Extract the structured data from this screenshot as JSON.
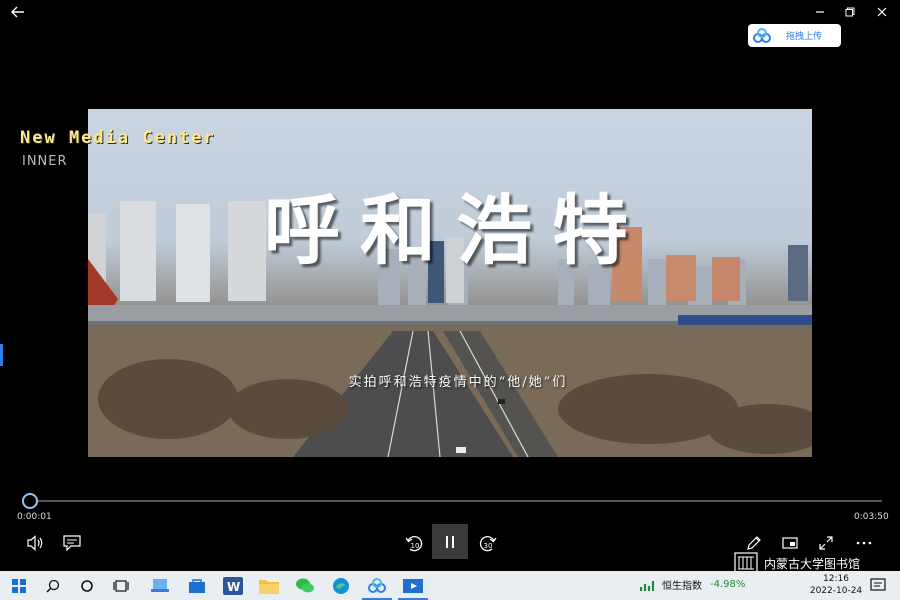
{
  "window": {
    "back_icon": "back-arrow-icon",
    "minimize_icon": "minimize-icon",
    "maximize_icon": "maximize-icon",
    "close_icon": "close-icon"
  },
  "upload": {
    "label": "拖拽上传",
    "icon": "baidu-cloud-icon",
    "accent": "#2f7de8"
  },
  "video": {
    "logo_text": "New Media Center",
    "logo_sub": "INNER",
    "title": "呼和浩特",
    "subtitle": "实拍呼和浩特疫情中的“他/她”们"
  },
  "player": {
    "current_time": "0:00:01",
    "total_time": "0:03:50",
    "progress_fraction": 0.004,
    "controls": {
      "volume": "volume-icon",
      "subtitles": "subtitles-icon",
      "rewind_10": "10",
      "forward_30": "30",
      "play_pause": "pause-icon",
      "edit": "pen-icon",
      "mini_view": "mini-view-icon",
      "fullscreen": "fullscreen-icon",
      "more": "more-icon"
    }
  },
  "watermark": {
    "text": "内蒙古大学图书馆"
  },
  "taskbar": {
    "stock_name": "恒生指数",
    "stock_change": "-4.98%",
    "time": "12:16",
    "date": "2022-10-24",
    "stock_change_color": "#1f8a3a"
  }
}
